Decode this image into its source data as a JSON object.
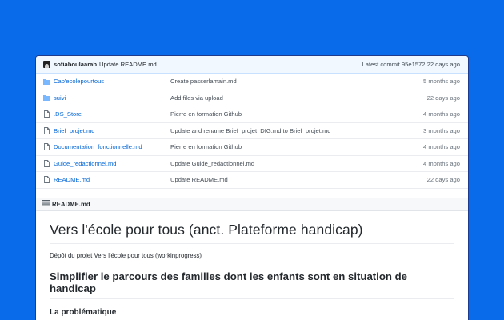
{
  "commit": {
    "user": "sofiaboulaarab",
    "message": "Update README.md",
    "latest": "Latest commit 95e1572 22 days ago"
  },
  "files": [
    {
      "type": "folder",
      "icon": "folder-icon",
      "name": "Cap'ecolepourtous",
      "message": "Create passerlamain.md",
      "age": "5 months ago"
    },
    {
      "type": "folder",
      "icon": "folder-icon",
      "name": "suivi",
      "message": "Add files via upload",
      "age": "22 days ago"
    },
    {
      "type": "file",
      "icon": "file-icon",
      "name": ".DS_Store",
      "message": "Pierre en formation Github",
      "age": "4 months ago"
    },
    {
      "type": "file",
      "icon": "file-icon",
      "name": "Brief_projet.md",
      "message": "Update and rename Brief_projet_DIG.md to Brief_projet.md",
      "age": "3 months ago"
    },
    {
      "type": "file",
      "icon": "file-icon",
      "name": "Documentation_fonctionnelle.md",
      "message": "Pierre en formation Github",
      "age": "4 months ago"
    },
    {
      "type": "file",
      "icon": "file-icon",
      "name": "Guide_redactionnel.md",
      "message": "Update Guide_redactionnel.md",
      "age": "4 months ago"
    },
    {
      "type": "file",
      "icon": "file-icon",
      "name": "README.md",
      "message": "Update README.md",
      "age": "22 days ago"
    }
  ],
  "readme": {
    "header": "README.md",
    "h1": "Vers l'école pour tous (anct. Plateforme handicap)",
    "intro": "Dépôt du projet Vers l'école pour tous (workinprogress)",
    "h2": "Simplifier le parcours des familles dont les enfants sont en situation de handicap",
    "h3": "La problématique"
  },
  "colors": {
    "background": "#0a6bea",
    "link": "#0366d6",
    "folder": "#79b8ff"
  }
}
